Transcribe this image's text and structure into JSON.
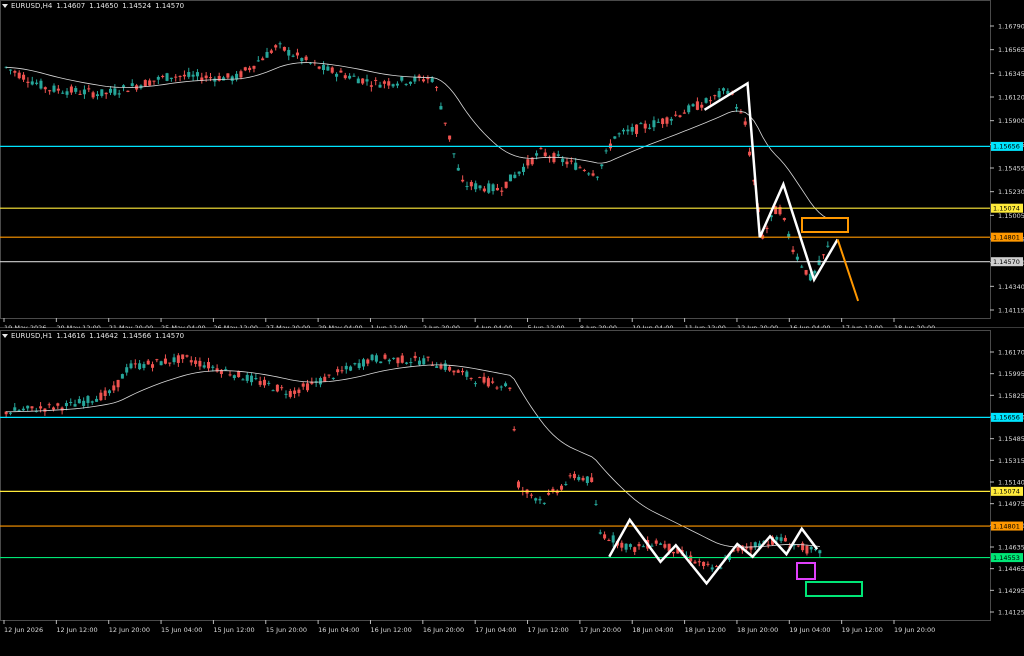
{
  "panels": [
    {
      "id": "h4",
      "header": {
        "symbol": "EURUSD,H4",
        "open": "1.14607",
        "high": "1.14650",
        "low": "1.14524",
        "close": "1.14570"
      },
      "price_range": [
        1.4115,
        1.1679
      ],
      "y_ticks": [
        "1.16790",
        "1.16565",
        "1.16345",
        "1.16120",
        "1.15900",
        "1.15675",
        "1.15455",
        "1.15230",
        "1.15005",
        "1.14785",
        "1.14570",
        "1.14340",
        "1.14115"
      ],
      "x_ticks": [
        "19 May 2026",
        "20 May 12:00",
        "21 May 20:00",
        "25 May 04:00",
        "26 May 12:00",
        "27 May 20:00",
        "29 May 04:00",
        "1 Jun 12:00",
        "2 Jun 20:00",
        "4 Jun 04:00",
        "5 Jun 12:00",
        "8 Jun 20:00",
        "10 Jun 04:00",
        "11 Jun 12:00",
        "12 Jun 20:00",
        "16 Jun 04:00",
        "17 Jun 12:00",
        "18 Jun 20:00"
      ],
      "levels": [
        {
          "price": 1.15656,
          "label": "1.15656",
          "color": "#00e5ff"
        },
        {
          "price": 1.15074,
          "label": "1.15074",
          "color": "#ffeb3b"
        },
        {
          "price": 1.14801,
          "label": "1.14801",
          "color": "#ff9800"
        },
        {
          "price": 1.1457,
          "label": "1.14570",
          "color": "#cfcfcf"
        }
      ],
      "zigzag": [
        [
          1.16,
          0.688
        ],
        [
          1.1625,
          0.73
        ],
        [
          1.148,
          0.742
        ],
        [
          1.153,
          0.765
        ],
        [
          1.144,
          0.795
        ],
        [
          1.1478,
          0.818
        ]
      ],
      "projection": [
        [
          1.1478,
          0.818
        ],
        [
          1.142,
          0.838
        ]
      ],
      "box": {
        "color": "#ff9800"
      }
    },
    {
      "id": "h1",
      "header": {
        "symbol": "EURUSD,H1",
        "open": "1.14616",
        "high": "1.14642",
        "low": "1.14566",
        "close": "1.14570"
      },
      "y_ticks": [
        "1.16170",
        "1.15995",
        "1.15825",
        "1.15650",
        "1.15485",
        "1.15315",
        "1.15140",
        "1.14975",
        "1.14800",
        "1.14635",
        "1.14465",
        "1.14295",
        "1.14125"
      ],
      "x_ticks": [
        "12 Jun 2026",
        "12 Jun 12:00",
        "12 Jun 20:00",
        "15 Jun 04:00",
        "15 Jun 12:00",
        "15 Jun 20:00",
        "16 Jun 04:00",
        "16 Jun 12:00",
        "16 Jun 20:00",
        "17 Jun 04:00",
        "17 Jun 12:00",
        "17 Jun 20:00",
        "18 Jun 04:00",
        "18 Jun 12:00",
        "18 Jun 20:00",
        "19 Jun 04:00",
        "19 Jun 12:00",
        "19 Jun 20:00"
      ],
      "levels": [
        {
          "price": 1.15656,
          "label": "1.15656",
          "color": "#00e5ff"
        },
        {
          "price": 1.15074,
          "label": "1.15074",
          "color": "#ffeb3b"
        },
        {
          "price": 1.14801,
          "label": "1.14801",
          "color": "#ff9800"
        },
        {
          "price": 1.14553,
          "label": "1.14553",
          "color": "#00e676"
        }
      ],
      "zigzag": [
        [
          1.1456,
          0.595
        ],
        [
          1.1485,
          0.615
        ],
        [
          1.1452,
          0.645
        ],
        [
          1.1465,
          0.66
        ],
        [
          1.1435,
          0.69
        ],
        [
          1.1466,
          0.72
        ],
        [
          1.1456,
          0.735
        ],
        [
          1.1472,
          0.752
        ],
        [
          1.1458,
          0.768
        ],
        [
          1.1478,
          0.783
        ],
        [
          1.1462,
          0.798
        ]
      ],
      "boxes": [
        {
          "color": "#e040fb"
        },
        {
          "color": "#00e676"
        }
      ]
    }
  ],
  "colors": {
    "bull": "#26a69a",
    "bear": "#ef5350",
    "ma": "#d9d9d9",
    "zigzag": "#ffffff",
    "projection": "#ff9800"
  }
}
